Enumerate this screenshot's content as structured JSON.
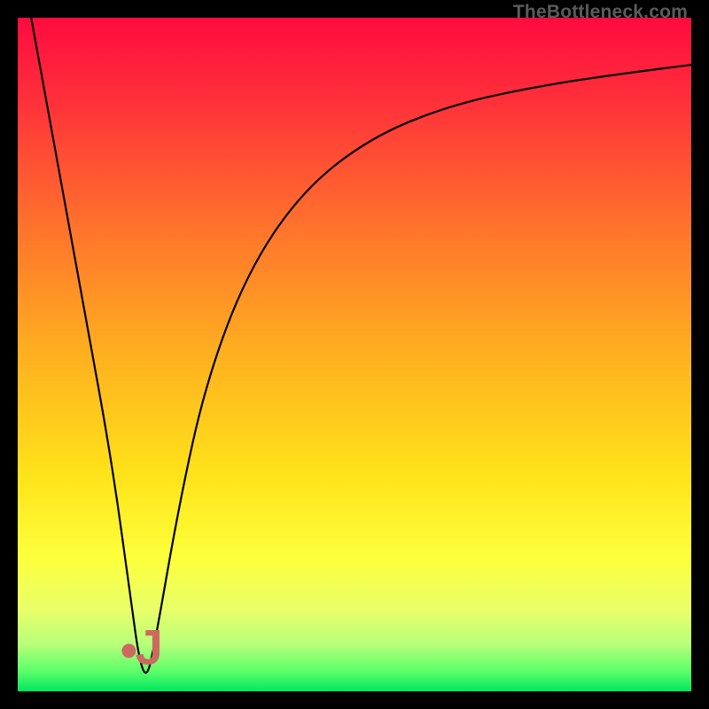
{
  "watermark": "TheBottleneck.com",
  "chart_data": {
    "type": "line",
    "title": "",
    "xlabel": "",
    "ylabel": "",
    "xlim": [
      0,
      100
    ],
    "ylim": [
      0,
      100
    ],
    "grid": false,
    "series": [
      {
        "name": "bottleneck-curve",
        "x": [
          2,
          6,
          10,
          14,
          17,
          18,
          19,
          20,
          24,
          28,
          34,
          42,
          52,
          64,
          78,
          92,
          100
        ],
        "y": [
          100,
          78,
          56,
          34,
          12,
          5,
          2,
          5,
          28,
          46,
          62,
          74,
          82,
          87,
          90,
          92,
          93
        ]
      }
    ],
    "marker": {
      "name": "optimum-marker",
      "glyph": "J",
      "dot_xy": [
        16.5,
        6
      ],
      "glyph_xy": [
        19.5,
        4
      ]
    },
    "gradient_stops": [
      {
        "offset": 0.0,
        "color": "#ff0b3f"
      },
      {
        "offset": 0.12,
        "color": "#ff2f3a"
      },
      {
        "offset": 0.3,
        "color": "#ff6f2d"
      },
      {
        "offset": 0.5,
        "color": "#ffb01f"
      },
      {
        "offset": 0.68,
        "color": "#ffe31a"
      },
      {
        "offset": 0.8,
        "color": "#fdff3a"
      },
      {
        "offset": 0.88,
        "color": "#e8ff6a"
      },
      {
        "offset": 0.93,
        "color": "#b8ff7a"
      },
      {
        "offset": 0.97,
        "color": "#5dff6a"
      },
      {
        "offset": 1.0,
        "color": "#00e85e"
      }
    ],
    "curve_color": "#000000",
    "marker_color": "#cc6a60"
  }
}
